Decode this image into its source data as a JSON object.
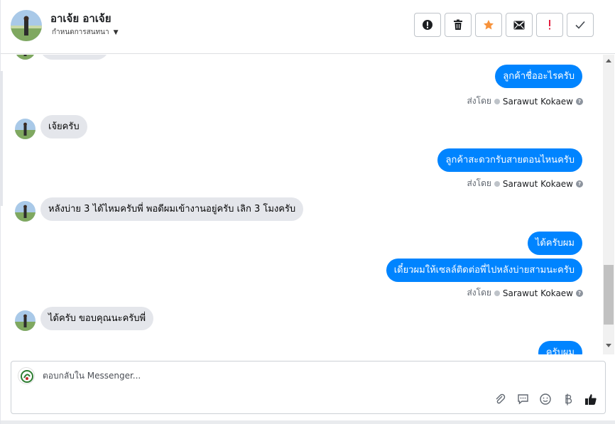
{
  "header": {
    "contact_name": "อาเจ้ย อาเจ้ย",
    "subtitle": "กำหนดการสนทนา"
  },
  "actions": [
    {
      "name": "alert-circle-button",
      "icon": "alert-circle-icon"
    },
    {
      "name": "delete-button",
      "icon": "trash-icon"
    },
    {
      "name": "star-button",
      "icon": "star-icon"
    },
    {
      "name": "mark-unread-button",
      "icon": "envelope-icon"
    },
    {
      "name": "mark-important-button",
      "icon": "exclamation-icon"
    },
    {
      "name": "mark-done-button",
      "icon": "checkmark-icon"
    }
  ],
  "messages": {
    "out_1": "ลูกค้าชื่ออะไรครับ",
    "in_1": "เจ้ยครับ",
    "out_2": "ลูกค้าสะดวกรับสายตอนไหนครับ",
    "in_2": "หลังบ่าย 3 ได้ไหมครับพี่ พอดีผมเข้างานอยู่ครับ เลิก 3 โมงครับ",
    "out_3": "ได้ครับผม",
    "out_4": "เดี๋ยวผมให้เซลล์ติดต่อพี่ไปหลังบ่ายสามนะครับ",
    "in_3": "ได้ครับ ขอบคุณนะครับพี่",
    "out_5": "ครับผม"
  },
  "sent_by": {
    "label": "ส่งโดย",
    "sender": "Sarawut Kokaew",
    "help": "?"
  },
  "composer": {
    "placeholder": "ตอบกลับใน Messenger..."
  },
  "colors": {
    "accent": "#0084ff",
    "star": "#f7923b",
    "important": "#e41e3f",
    "incoming_bubble": "#e4e6eb"
  }
}
